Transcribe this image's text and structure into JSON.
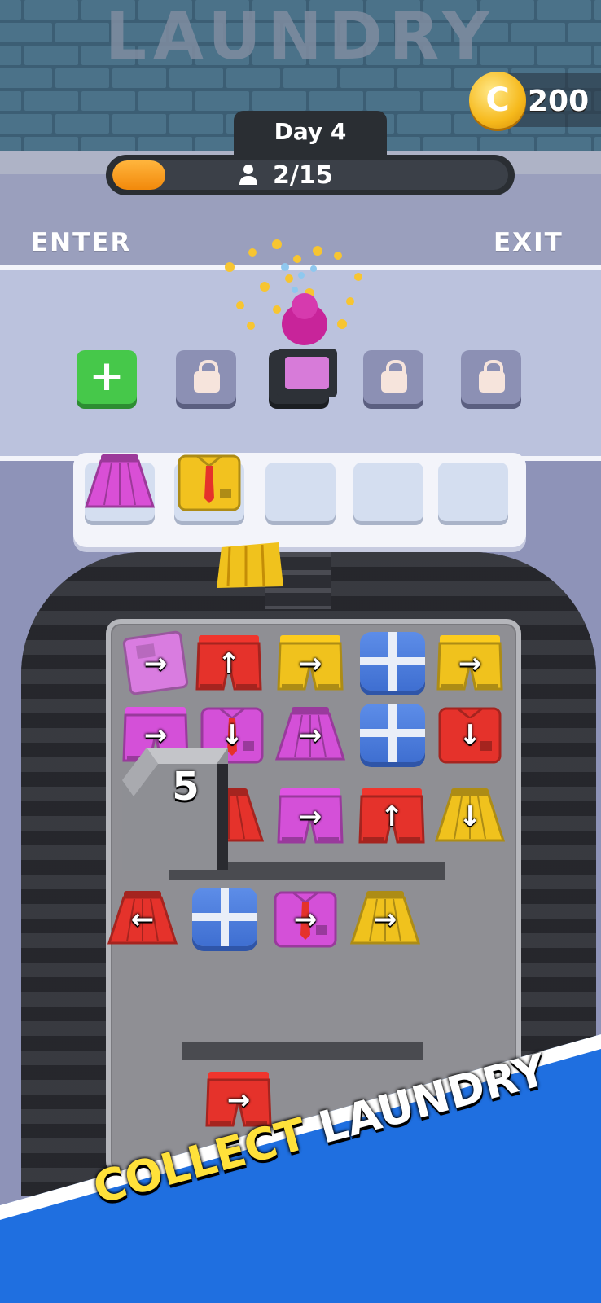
{
  "wall_sign": "LAUNDRY",
  "coins": {
    "value": "200",
    "icon": "coin-icon",
    "symbol": "C"
  },
  "day": {
    "label": "Day 4"
  },
  "progress": {
    "text": "2/15",
    "fraction": 0.133,
    "icon": "person-icon"
  },
  "labels": {
    "enter": "ENTER",
    "exit": "EXIT"
  },
  "slots": [
    {
      "state": "add",
      "symbol": "+"
    },
    {
      "state": "locked"
    },
    {
      "state": "active"
    },
    {
      "state": "locked"
    },
    {
      "state": "locked"
    }
  ],
  "basket": [
    {
      "item": "skirt",
      "color": "#d94fd6"
    },
    {
      "item": "shirt",
      "color": "#f2c21f"
    },
    {
      "item": "empty"
    },
    {
      "item": "empty"
    },
    {
      "item": "empty"
    }
  ],
  "board": {
    "tiles": [
      {
        "item": "jeans",
        "color": "#d97ce0",
        "arrow": "→"
      },
      {
        "item": "shorts",
        "color": "#e5322b",
        "arrow": "↑"
      },
      {
        "item": "shorts",
        "color": "#f0c21d",
        "arrow": "→"
      },
      {
        "item": "crate"
      },
      {
        "item": "shorts",
        "color": "#f0c21d",
        "arrow": "→"
      },
      {
        "item": "shorts",
        "color": "#d450d8",
        "arrow": "→"
      },
      {
        "item": "shirt",
        "color": "#d450d8",
        "arrow": "↓"
      },
      {
        "item": "skirt",
        "color": "#d450d8",
        "arrow": "→"
      },
      {
        "item": "crate"
      },
      {
        "item": "shirt",
        "color": "#e5322b",
        "arrow": "↓"
      },
      {
        "item": "skirt",
        "color": "#e5322b",
        "arrow": ""
      },
      {
        "item": "shorts",
        "color": "#d450d8",
        "arrow": "→"
      },
      {
        "item": "shorts",
        "color": "#e5322b",
        "arrow": "↑"
      },
      {
        "item": "skirt",
        "color": "#f0c21d",
        "arrow": "↓"
      },
      {
        "item": "skirt",
        "color": "#e5322b",
        "arrow": "←"
      },
      {
        "item": "crate"
      },
      {
        "item": "shirt",
        "color": "#d450d8",
        "arrow": "→"
      },
      {
        "item": "skirt",
        "color": "#f0c21d",
        "arrow": "→"
      },
      {
        "item": "shorts",
        "color": "#e5322b",
        "arrow": "→"
      }
    ],
    "block_count": "5"
  },
  "banner": {
    "word1": "COLLECT",
    "word2": "LAUNDRY"
  },
  "colors": {
    "accent": "#f2890b",
    "banner": "#1f6fe0",
    "conveyor": "#2c2d33"
  }
}
